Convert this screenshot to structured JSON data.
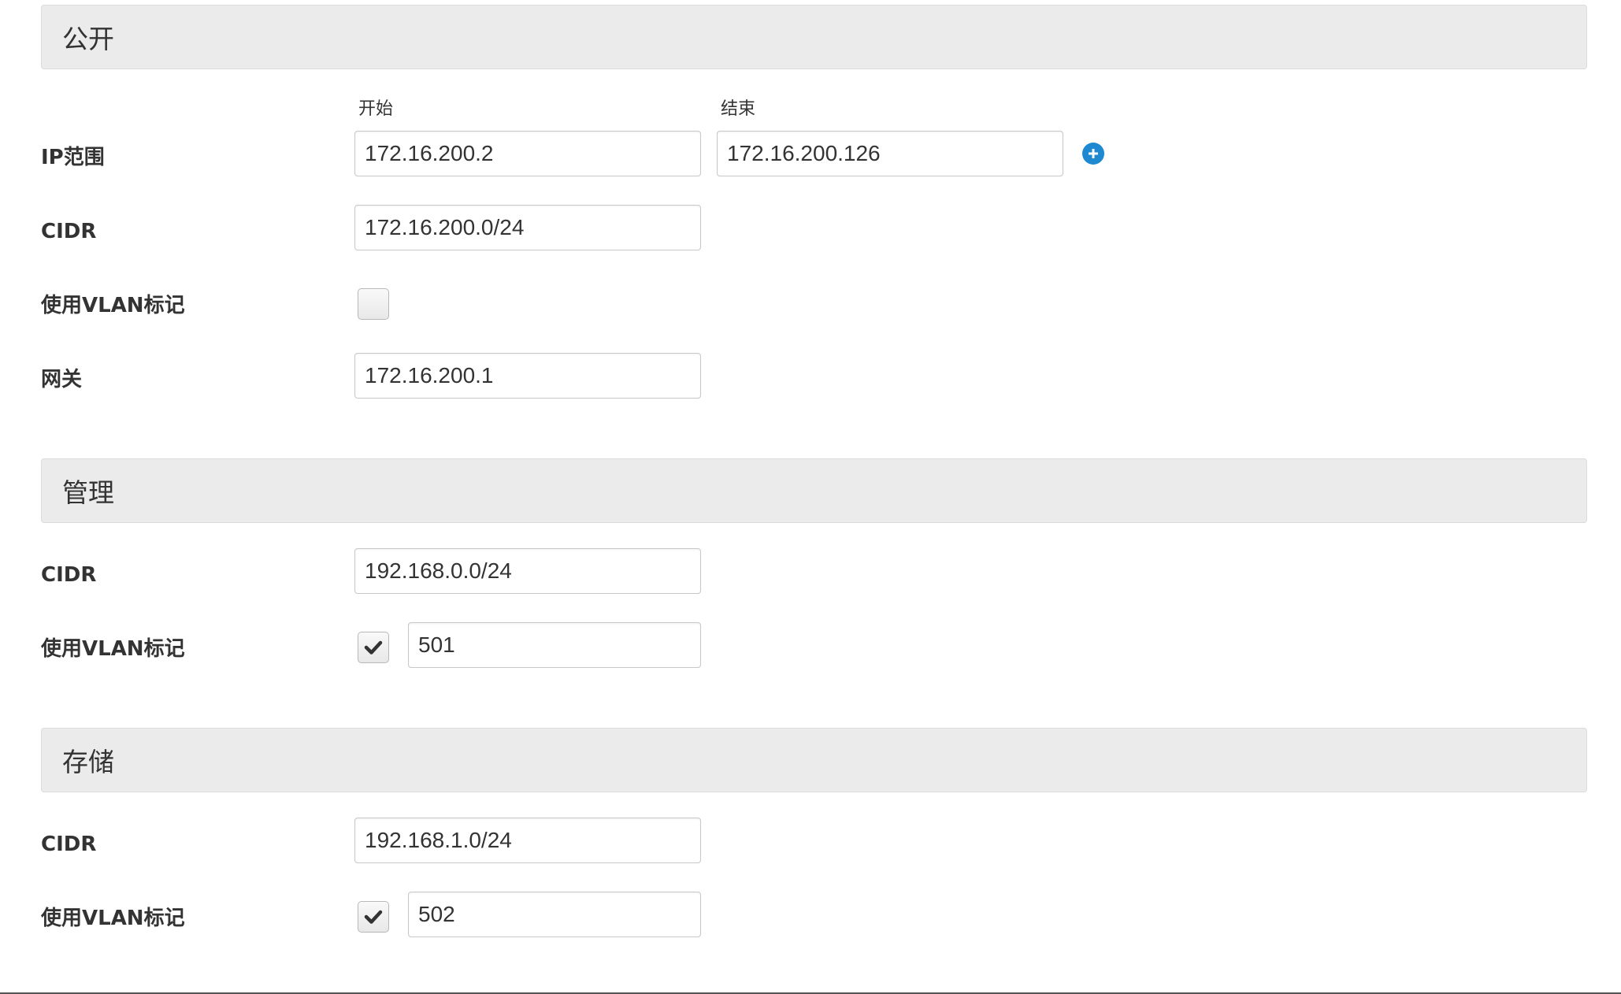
{
  "public": {
    "title": "公开",
    "ip_range": {
      "label": "IP范围",
      "start_label": "开始",
      "end_label": "结束",
      "start_value": "172.16.200.2",
      "end_value": "172.16.200.126",
      "add_icon": "plus-circle-icon"
    },
    "cidr": {
      "label": "CIDR",
      "value": "172.16.200.0/24"
    },
    "vlan": {
      "label": "使用VLAN标记",
      "checked": false
    },
    "gateway": {
      "label": "网关",
      "value": "172.16.200.1"
    }
  },
  "management": {
    "title": "管理",
    "cidr": {
      "label": "CIDR",
      "value": "192.168.0.0/24"
    },
    "vlan": {
      "label": "使用VLAN标记",
      "checked": true,
      "value": "501"
    }
  },
  "storage": {
    "title": "存储",
    "cidr": {
      "label": "CIDR",
      "value": "192.168.1.0/24"
    },
    "vlan": {
      "label": "使用VLAN标记",
      "checked": true,
      "value": "502"
    }
  },
  "colors": {
    "header_bg": "#ebebeb",
    "accent": "#1e88d0",
    "text": "#333333"
  }
}
